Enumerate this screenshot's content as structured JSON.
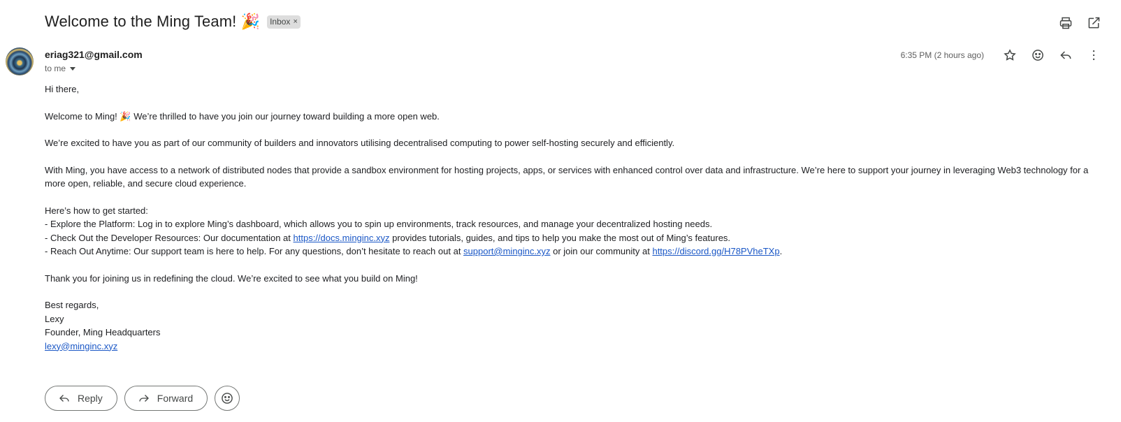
{
  "subject": "Welcome to the Ming Team! 🎉",
  "label": {
    "name": "Inbox",
    "remove": "×"
  },
  "sender": {
    "email": "eriag321@gmail.com",
    "recipient": "to me"
  },
  "timestamp": "6:35 PM (2 hours ago)",
  "icons": {
    "print": "print-icon",
    "popout": "open-in-new-window-icon",
    "star": "star-icon",
    "emoji": "emoji-reaction-icon",
    "reply": "reply-icon",
    "more": "more-vert-icon"
  },
  "body": {
    "greeting": "Hi there,",
    "welcome": "Welcome to Ming! 🎉 We’re thrilled to have you join our journey toward building a more open web.",
    "excited": "We’re excited to have you as part of our community of builders and innovators utilising decentralised computing to power self-hosting securely and efficiently.",
    "access": "With Ming, you have access to a network of distributed nodes that provide a sandbox environment for hosting projects, apps, or services with enhanced control over data and infrastructure. We’re here to support your journey in leveraging Web3 technology for a more open, reliable, and secure cloud experience.",
    "started_heading": "Here’s how to get started:",
    "step1": "- Explore the Platform: Log in to explore Ming’s dashboard, which allows you to spin up environments, track resources, and manage your decentralized hosting needs.",
    "step2_pre": "- Check Out the Developer Resources: Our documentation at ",
    "step2_link": "https://docs.minginc.xyz",
    "step2_post": " provides tutorials, guides, and tips to help you make the most out of Ming’s features.",
    "step3_pre": "- Reach Out Anytime: Our support team is here to help. For any questions, don’t hesitate to reach out at ",
    "step3_email": "support@minginc.xyz",
    "step3_mid": " or join our community at ",
    "step3_link": "https://discord.gg/H78PVheTXp",
    "step3_post": ".",
    "thanks": "Thank you for joining us in redefining the cloud. We’re excited to see what you build on Ming!",
    "signoff": "Best regards,",
    "sig_name": "Lexy",
    "sig_title": "Founder, Ming Headquarters",
    "sig_email": "lexy@minginc.xyz"
  },
  "actions": {
    "reply": "Reply",
    "forward": "Forward"
  }
}
